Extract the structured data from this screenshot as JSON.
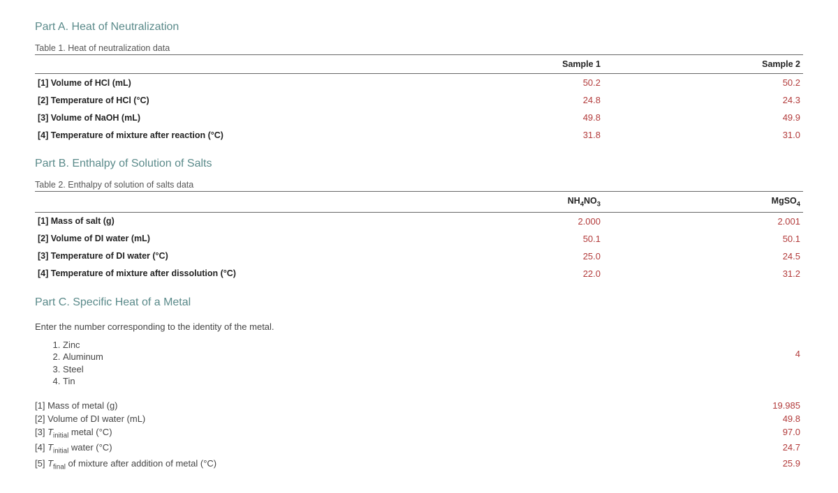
{
  "partA": {
    "title": "Part A. Heat of Neutralization",
    "caption": "Table 1. Heat of neutralization data",
    "headers": {
      "col1": "Sample 1",
      "col2": "Sample 2"
    },
    "rows": [
      {
        "label": "[1] Volume of HCl (mL)",
        "v1": "50.2",
        "v2": "50.2"
      },
      {
        "label": "[2] Temperature of HCl (°C)",
        "v1": "24.8",
        "v2": "24.3"
      },
      {
        "label": "[3] Volume of NaOH (mL)",
        "v1": "49.8",
        "v2": "49.9"
      },
      {
        "label": "[4] Temperature of mixture after reaction (°C)",
        "v1": "31.8",
        "v2": "31.0"
      }
    ]
  },
  "partB": {
    "title": "Part B. Enthalpy of Solution of Salts",
    "caption": "Table 2. Enthalpy of solution of salts data",
    "headers": {
      "col1_pre": "NH",
      "col1_sub": "4",
      "col1_mid": "NO",
      "col1_sub2": "3",
      "col2_pre": "MgSO",
      "col2_sub": "4"
    },
    "rows": [
      {
        "label": "[1] Mass of salt (g)",
        "v1": "2.000",
        "v2": "2.001"
      },
      {
        "label": "[2] Volume of DI water (mL)",
        "v1": "50.1",
        "v2": "50.1"
      },
      {
        "label": "[3] Temperature of DI water (°C)",
        "v1": "25.0",
        "v2": "24.5"
      },
      {
        "label": "[4] Temperature of mixture after dissolution (°C)",
        "v1": "22.0",
        "v2": "31.2"
      }
    ]
  },
  "partC": {
    "title": "Part C. Specific Heat of a Metal",
    "instruction": "Enter the number corresponding to the identity of the metal.",
    "metals": [
      "Zinc",
      "Aluminum",
      "Steel",
      "Tin"
    ],
    "metal_answer": "4",
    "rows": [
      {
        "n": "[1]",
        "plain": "Mass of metal (g)",
        "value": "19.985"
      },
      {
        "n": "[2]",
        "plain": "Volume of DI water (mL)",
        "value": "49.8"
      },
      {
        "n": "[3]",
        "ital": "T",
        "sub": "initial",
        "plain": " metal (°C)",
        "value": "97.0"
      },
      {
        "n": "[4]",
        "ital": "T",
        "sub": "initial",
        "plain": " water (°C)",
        "value": "24.7"
      },
      {
        "n": "[5]",
        "ital": "T",
        "sub": "final",
        "plain": " of mixture after addition of metal (°C)",
        "value": "25.9"
      }
    ]
  }
}
